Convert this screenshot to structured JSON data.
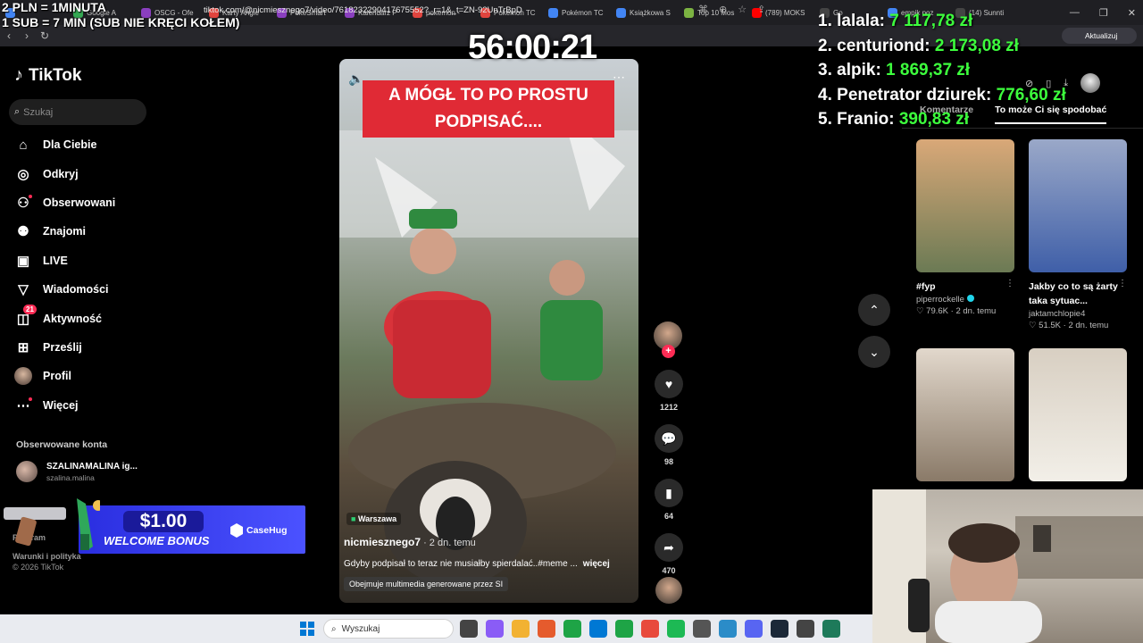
{
  "browser": {
    "tabs": [
      {
        "label": "",
        "color": "#4285f4"
      },
      {
        "label": "Google A",
        "color": "#34a853"
      },
      {
        "label": "OSCG - Ofe",
        "color": "#8a3fbf"
      },
      {
        "label": "Karty Angie",
        "color": "#e0443e"
      },
      {
        "label": "PokeSmart",
        "color": "#8a3fbf"
      },
      {
        "label": "Kalendarz P",
        "color": "#8a3fbf"
      },
      {
        "label": "pokemon -",
        "color": "#e0443e"
      },
      {
        "label": "Pokémon TC",
        "color": "#e0443e"
      },
      {
        "label": "Pokémon TC",
        "color": "#4285f4"
      },
      {
        "label": "Książkowa S",
        "color": "#4285f4"
      },
      {
        "label": "Top 10 Mos",
        "color": "#7cb342"
      },
      {
        "label": "(789) MOKS",
        "color": "#ff0000"
      },
      {
        "label": "Go",
        "color": "#444"
      },
      {
        "label": "empik poz",
        "color": "#4285f4"
      },
      {
        "label": "(14) Sunnti",
        "color": "#444"
      }
    ],
    "url": "tiktok.com/@nicmiesznego7/video/7618232290417675552?_r=1&_t=ZN-92UnTrBpD",
    "update_label": "Aktualizuj"
  },
  "overlay": {
    "line1": "2 PLN =  1MINUTA",
    "line2": "1 SUB = 7 MIN (SUB NIE KRĘCI KOŁEM)",
    "timer": "56:00:21"
  },
  "tiktok": {
    "brand": "TikTok",
    "search_placeholder": "Szukaj",
    "nav": [
      {
        "label": "Dla Ciebie",
        "icon": "home-icon"
      },
      {
        "label": "Odkryj",
        "icon": "compass-icon"
      },
      {
        "label": "Obserwowani",
        "icon": "following-icon"
      },
      {
        "label": "Znajomi",
        "icon": "friends-icon"
      },
      {
        "label": "LIVE",
        "icon": "live-icon"
      },
      {
        "label": "Wiadomości",
        "icon": "messages-icon"
      },
      {
        "label": "Aktywność",
        "icon": "activity-icon",
        "badge": "21"
      },
      {
        "label": "Prześlij",
        "icon": "upload-icon"
      },
      {
        "label": "Profil",
        "icon": "profile-icon"
      },
      {
        "label": "Więcej",
        "icon": "more-icon"
      }
    ],
    "followed_title": "Obserwowane konta",
    "followed": [
      {
        "name": "SZALINAMALINA ig...",
        "handle": "szalina.malina"
      }
    ],
    "footer": [
      "Program",
      "Warunki i polityka"
    ],
    "copyright": "© 2026 TikTok"
  },
  "casino": {
    "amount": "$1.00",
    "label": "WELCOME BONUS",
    "brand": "CaseHug"
  },
  "video": {
    "caption": "A MÓGŁ TO PO PROSTU PODPISAĆ....",
    "location": "Warszawa",
    "author": "nicmiesznego7",
    "posted": " · 2 dn. temu",
    "description": "Gdyby podpisał to teraz nie musiałby spierdalać..#meme ...",
    "more": "więcej",
    "ai_note": "Obejmuje multimedia generowane przez SI",
    "likes": "1212",
    "comments": "98",
    "saves": "64",
    "shares": "470"
  },
  "donations": [
    {
      "rank": "1.",
      "name": "lalala:",
      "amount": "7 117,78 zł"
    },
    {
      "rank": "2.",
      "name": "centuriond:",
      "amount": "2 173,08 zł"
    },
    {
      "rank": "3.",
      "name": "alpik:",
      "amount": "1 869,37 zł"
    },
    {
      "rank": "4.",
      "name": "Penetrator dziurek:",
      "amount": "776,60 zł"
    },
    {
      "rank": "5.",
      "name": "Franio:",
      "amount": "390,83 zł"
    }
  ],
  "right_panel": {
    "tabs": [
      "Komentarze",
      "To może Ci się spodobać"
    ],
    "cards": [
      {
        "title": "#fyp",
        "author": "piperrockelle",
        "likes": "79.6K",
        "ago": "2 dn. temu",
        "colors": [
          "#d9a878",
          "#6b7a54"
        ]
      },
      {
        "title": "Jakby co to są żarty taka sytuac...",
        "author": "jaktamchlopie4",
        "likes": "51.5K",
        "ago": "2 dn. temu",
        "colors": [
          "#9aa8c8",
          "#3f5fa8"
        ]
      },
      {
        "title": "",
        "author": "",
        "likes": "",
        "ago": "",
        "colors": [
          "#e2d8cc",
          "#8a7a68"
        ]
      },
      {
        "title": "",
        "author": "",
        "likes": "",
        "ago": "",
        "colors": [
          "#d8cfc2",
          "#f2efe8"
        ]
      }
    ]
  },
  "taskbar": {
    "search_placeholder": "Wyszukaj",
    "apps": [
      "#444",
      "#8a5cf6",
      "#f2b233",
      "#e55b2d",
      "#1ea446",
      "#0078d4",
      "#1ea446",
      "#e84a3c",
      "#1db954",
      "#555",
      "#2b8cc8",
      "#5865f2",
      "#1b2838",
      "#444",
      "#1e7a5a"
    ]
  }
}
